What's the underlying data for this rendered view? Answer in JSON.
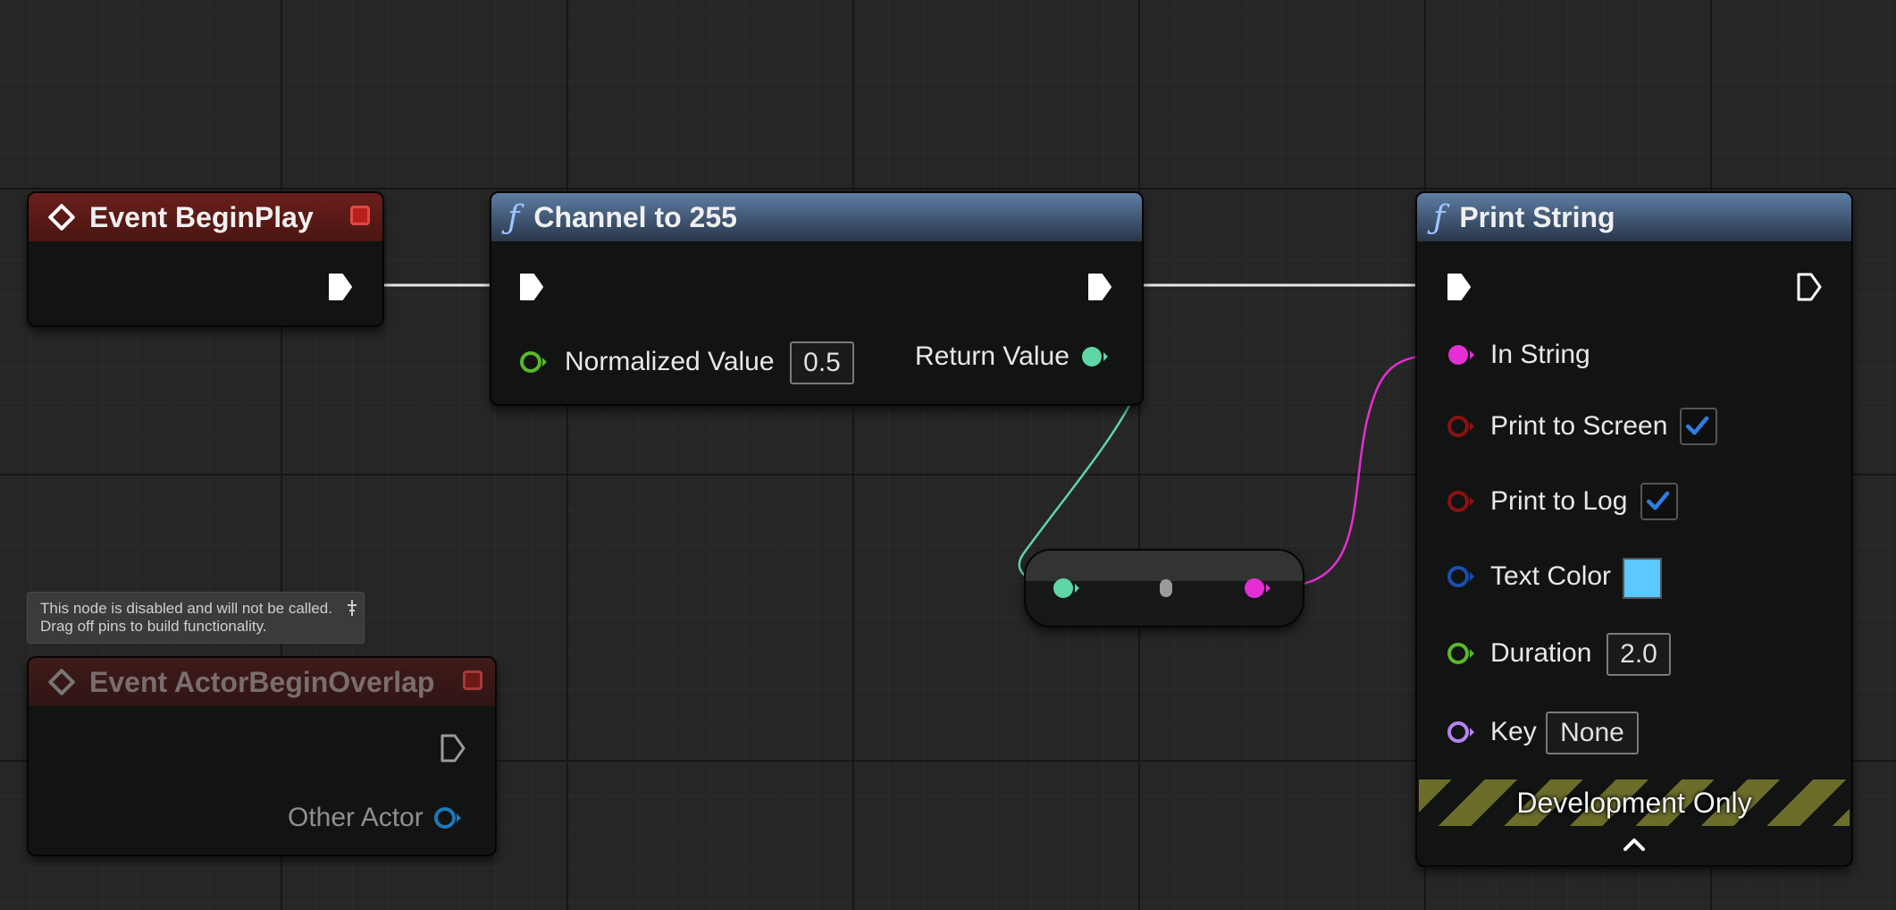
{
  "nodes": {
    "event_begin_play": {
      "title": "Event BeginPlay"
    },
    "channel_to_255": {
      "title": "Channel to 255",
      "input_label": "Normalized Value",
      "input_value": "0.5",
      "output_label": "Return Value"
    },
    "print_string": {
      "title": "Print String",
      "pins": {
        "in_string": "In String",
        "print_to_screen": "Print to Screen",
        "print_to_log": "Print to Log",
        "text_color": "Text Color",
        "duration": "Duration",
        "duration_value": "2.0",
        "key": "Key",
        "key_value": "None"
      },
      "print_to_screen_checked": true,
      "print_to_log_checked": true,
      "text_color_value": "#5bc8ff",
      "banner": "Development Only"
    },
    "event_actor_begin_overlap": {
      "title": "Event ActorBeginOverlap",
      "output_label": "Other Actor",
      "tooltip_line1": "This node is disabled and will not be called.",
      "tooltip_line2": "Drag off pins to build functionality."
    }
  },
  "colors": {
    "exec_wire": "#ffffff",
    "float_pin": "#5fd6a6",
    "string_pin": "#e62ed5",
    "bool_pin": "#8b1212",
    "struct_pin": "#1a4fb0",
    "float_in_pin": "#58b82a",
    "name_pin": "#b682ef",
    "object_pin": "#1f78b8"
  }
}
